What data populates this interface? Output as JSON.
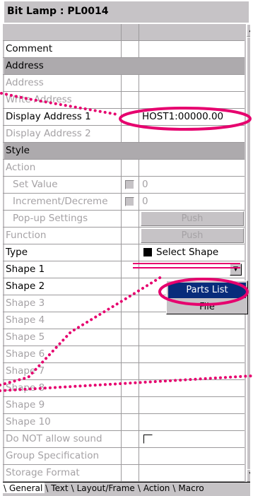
{
  "title": "Bit Lamp : PL0014",
  "rows": [
    {
      "label": "Comment",
      "value": ""
    },
    {
      "label": "Address",
      "section": true
    },
    {
      "label": "Address",
      "value": ""
    },
    {
      "label": "Write Address",
      "value": ""
    },
    {
      "label": "Display Address 1",
      "value": "HOST1:00000.00"
    },
    {
      "label": "Display Address 2",
      "value": ""
    },
    {
      "label": "Style",
      "section": true
    },
    {
      "label": "Action",
      "value": ""
    },
    {
      "label": "Set Value",
      "value": "0"
    },
    {
      "label": "Increment/Decreme",
      "value": "0"
    },
    {
      "label": "Pop-up Settings",
      "value": "Push"
    },
    {
      "label": "Function",
      "value": "Push"
    },
    {
      "label": "Type",
      "value": "Select Shape"
    },
    {
      "label": "Shape 1",
      "value": ""
    },
    {
      "label": "Shape 2",
      "value": ""
    },
    {
      "label": "Shape 3",
      "value": ""
    },
    {
      "label": "Shape 4",
      "value": ""
    },
    {
      "label": "Shape 5",
      "value": ""
    },
    {
      "label": "Shape 6",
      "value": ""
    },
    {
      "label": "Shape 7",
      "value": ""
    },
    {
      "label": "Shape 8",
      "value": ""
    },
    {
      "label": "Shape 9",
      "value": ""
    },
    {
      "label": "Shape 10",
      "value": ""
    },
    {
      "label": "Do NOT allow sound",
      "value": ""
    },
    {
      "label": "Group Specification",
      "value": ""
    },
    {
      "label": "Storage Format",
      "value": ""
    }
  ],
  "dropdown_menu": [
    "Parts List",
    "File"
  ],
  "tabs": [
    "General",
    "Text",
    "Layout/Frame",
    "Action",
    "Macro"
  ],
  "colors": {
    "highlight": "#e6006e",
    "selection": "#082c7b",
    "section": "#adaaad"
  }
}
